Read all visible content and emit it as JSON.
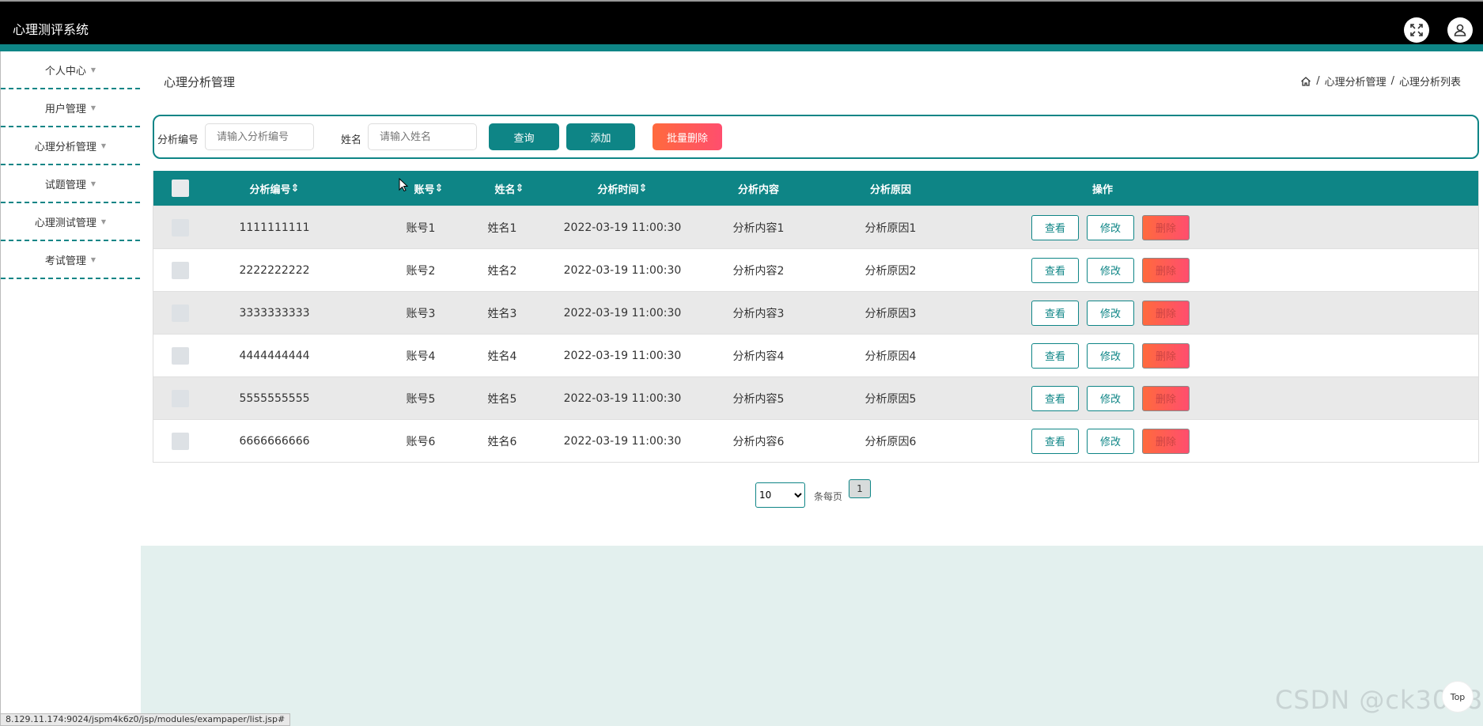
{
  "app": {
    "title": "心理测评系统"
  },
  "header": {
    "fullscreen_icon": "fullscreen-icon",
    "user_icon": "user-icon"
  },
  "sidebar": {
    "items": [
      {
        "label": "个人中心"
      },
      {
        "label": "用户管理"
      },
      {
        "label": "心理分析管理"
      },
      {
        "label": "试题管理"
      },
      {
        "label": "心理测试管理"
      },
      {
        "label": "考试管理"
      }
    ]
  },
  "page": {
    "title": "心理分析管理",
    "breadcrumb": {
      "sep": "/",
      "level1": "心理分析管理",
      "level2": "心理分析列表"
    }
  },
  "search": {
    "field1_label": "分析编号",
    "field1_placeholder": "请输入分析编号",
    "field2_label": "姓名",
    "field2_placeholder": "请输入姓名",
    "query_label": "查询",
    "add_label": "添加",
    "batch_delete_label": "批量删除"
  },
  "table": {
    "headers": {
      "code": "分析编号",
      "account": "账号",
      "name": "姓名",
      "time": "分析时间",
      "content": "分析内容",
      "reason": "分析原因",
      "actions": "操作"
    },
    "sort_icon": "⇕",
    "action_labels": {
      "view": "查看",
      "edit": "修改",
      "delete": "删除"
    },
    "rows": [
      {
        "code": "1111111111",
        "account": "账号1",
        "name": "姓名1",
        "time": "2022-03-19 11:00:30",
        "content": "分析内容1",
        "reason": "分析原因1"
      },
      {
        "code": "2222222222",
        "account": "账号2",
        "name": "姓名2",
        "time": "2022-03-19 11:00:30",
        "content": "分析内容2",
        "reason": "分析原因2"
      },
      {
        "code": "3333333333",
        "account": "账号3",
        "name": "姓名3",
        "time": "2022-03-19 11:00:30",
        "content": "分析内容3",
        "reason": "分析原因3"
      },
      {
        "code": "4444444444",
        "account": "账号4",
        "name": "姓名4",
        "time": "2022-03-19 11:00:30",
        "content": "分析内容4",
        "reason": "分析原因4"
      },
      {
        "code": "5555555555",
        "account": "账号5",
        "name": "姓名5",
        "time": "2022-03-19 11:00:30",
        "content": "分析内容5",
        "reason": "分析原因5"
      },
      {
        "code": "6666666666",
        "account": "账号6",
        "name": "姓名6",
        "time": "2022-03-19 11:00:30",
        "content": "分析内容6",
        "reason": "分析原因6"
      }
    ]
  },
  "pagination": {
    "page_size": "10",
    "per_page_label": "条每页",
    "current_page": "1"
  },
  "status_bar": {
    "url": "8.129.11.174:9024/jspm4k6z0/jsp/modules/exampaper/list.jsp#"
  },
  "back_to_top": {
    "label": "Top"
  },
  "watermark": {
    "text": "CSDN @ck3018"
  },
  "colors": {
    "accent": "#0e8586",
    "danger": "#ff5a4e",
    "footer_bg": "#e3f0ee"
  }
}
